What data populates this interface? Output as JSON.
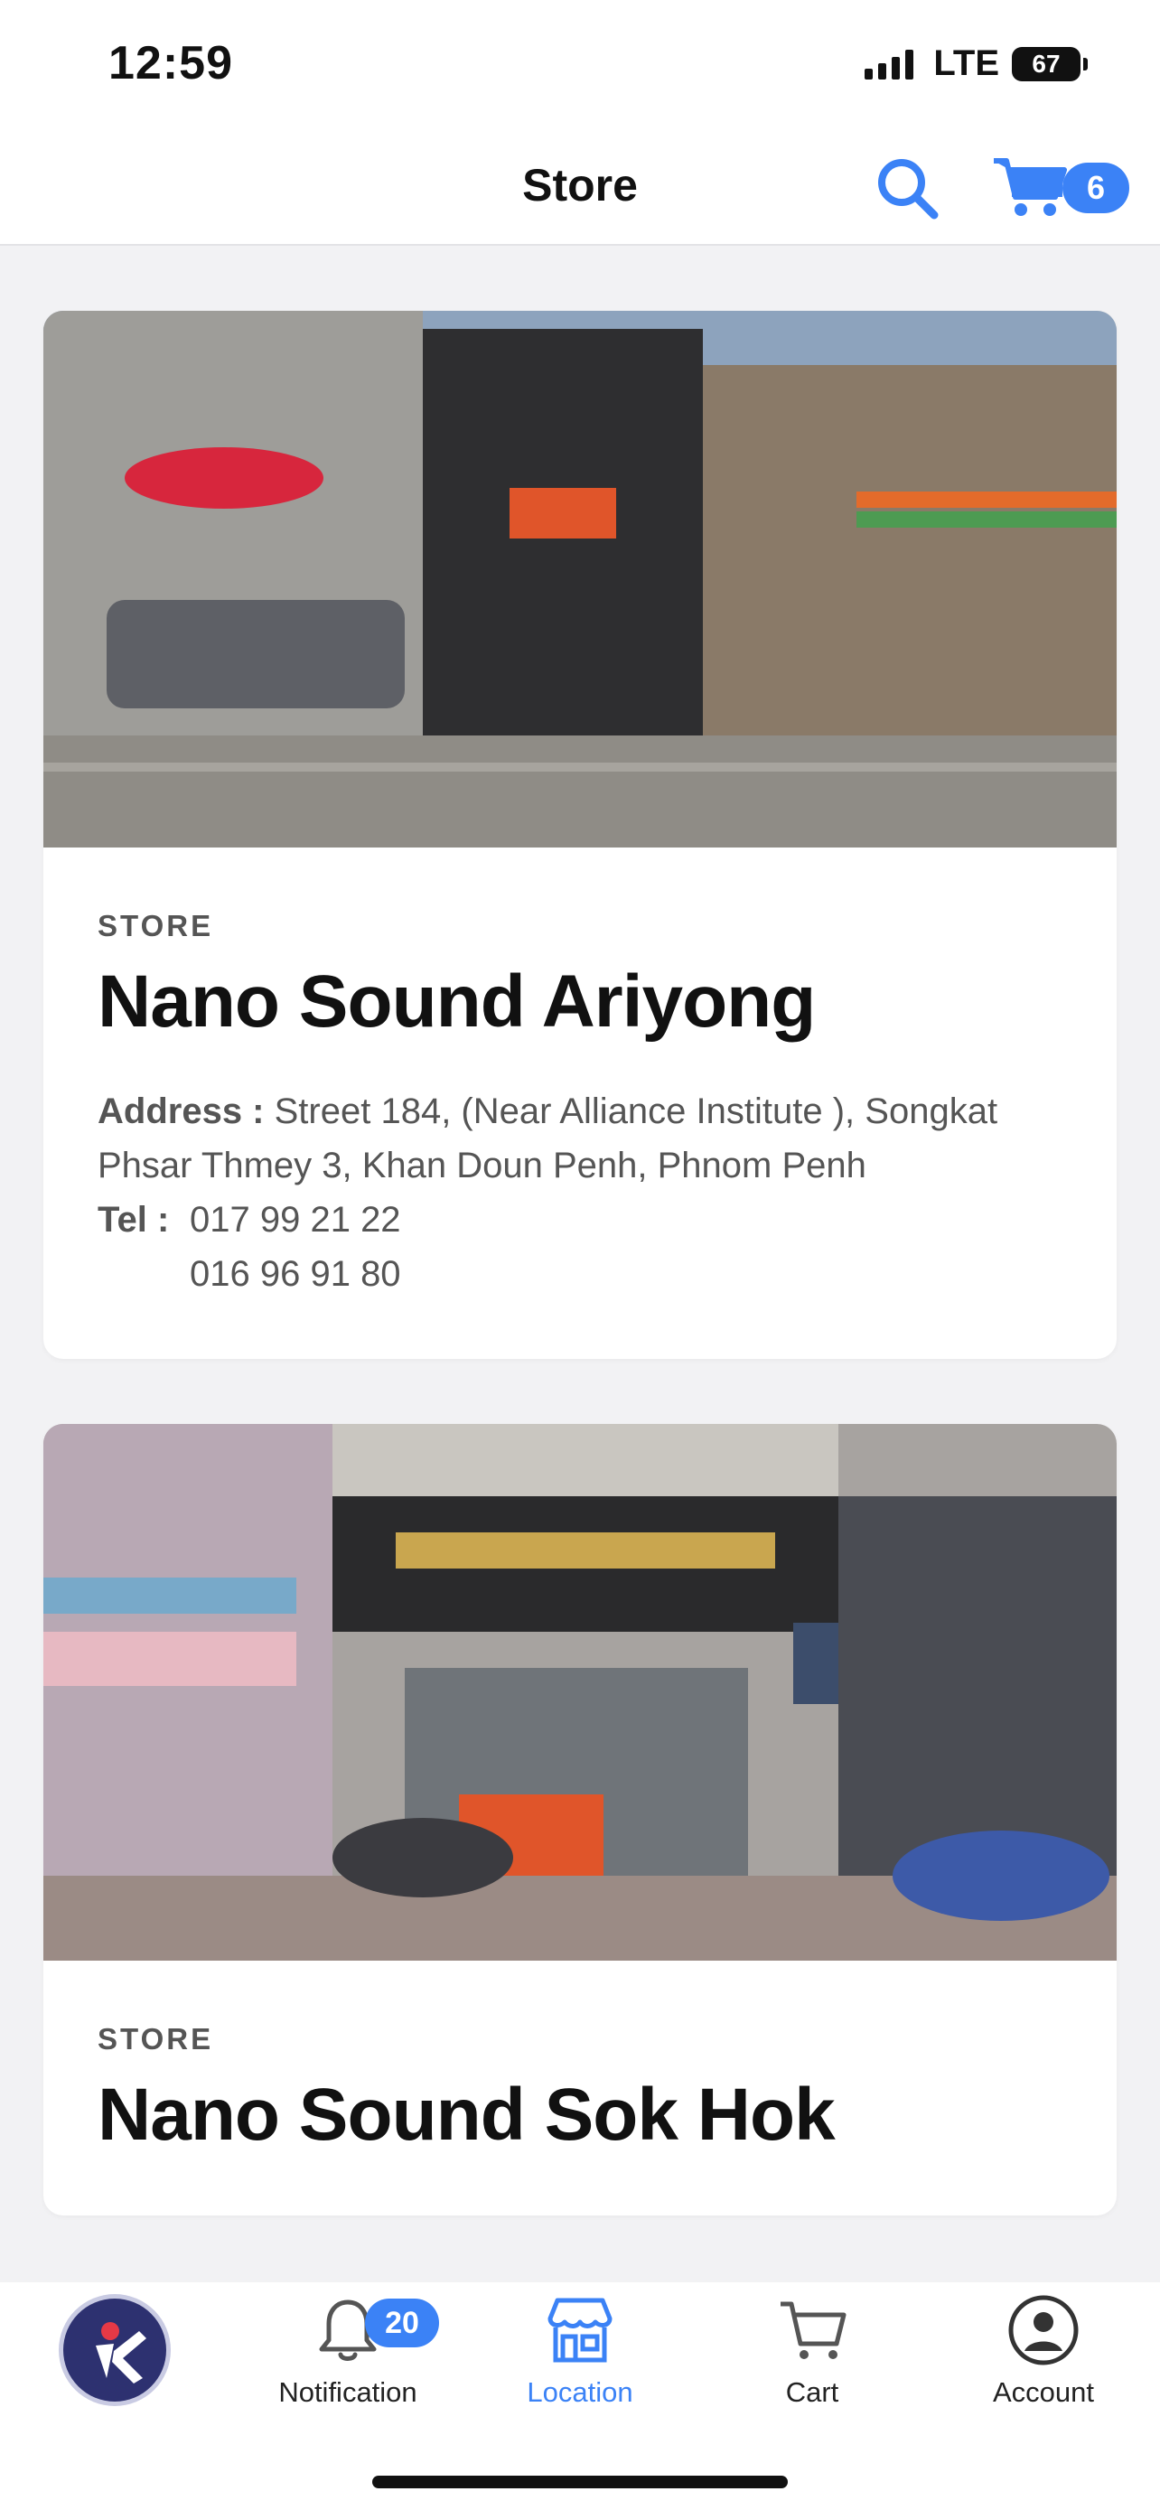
{
  "status_bar": {
    "time": "12:59",
    "network": "LTE",
    "battery": "67"
  },
  "header": {
    "title": "Store",
    "cart_count": "6"
  },
  "stores": [
    {
      "kicker": "STORE",
      "name": "Nano Sound Ariyong",
      "address_label": "Address :",
      "address": "Street 184, (Near Alliance Institute ), Songkat Phsar Thmey 3, Khan Doun Penh, Phnom Penh",
      "tel_label": "Tel :",
      "phones": [
        "017 99 21 22",
        "016 96 91 80"
      ]
    },
    {
      "kicker": "STORE",
      "name": "Nano Sound Sok Hok"
    }
  ],
  "nav": {
    "notification_label": "Notification",
    "notification_count": "20",
    "location_label": "Location",
    "cart_label": "Cart",
    "account_label": "Account"
  },
  "colors": {
    "accent": "#3b82f6",
    "logo_bg": "#2d3170",
    "logo_accent": "#e63946"
  }
}
